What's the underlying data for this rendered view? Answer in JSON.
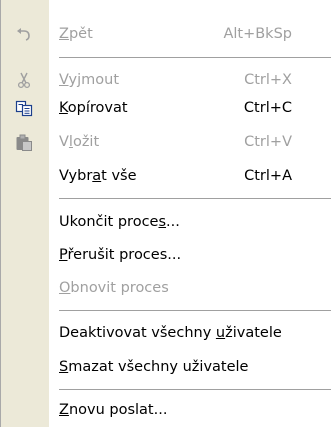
{
  "menu": {
    "items": [
      {
        "name": "undo",
        "pre": "",
        "key": "Z",
        "post": "pět",
        "shortcut": "Alt+BkSp",
        "icon": "undo-icon",
        "disabled": true
      },
      {
        "name": "cut",
        "pre": "",
        "key": "V",
        "post": "yjmout",
        "shortcut": "Ctrl+X",
        "icon": "scissors-icon",
        "disabled": true
      },
      {
        "name": "copy",
        "pre": "",
        "key": "K",
        "post": "opírovat",
        "shortcut": "Ctrl+C",
        "icon": "copy-icon",
        "disabled": false
      },
      {
        "name": "paste",
        "pre": "V",
        "key": "l",
        "post": "ožit",
        "shortcut": "Ctrl+V",
        "icon": "paste-icon",
        "disabled": true
      },
      {
        "name": "select-all",
        "pre": "Vybr",
        "key": "a",
        "post": "t vše",
        "shortcut": "Ctrl+A",
        "icon": "",
        "disabled": false
      },
      {
        "name": "end-process",
        "pre": "Ukončit proce",
        "key": "s",
        "post": "...",
        "shortcut": "",
        "icon": "",
        "disabled": false
      },
      {
        "name": "interrupt-process",
        "pre": "",
        "key": "P",
        "post": "řerušit proces...",
        "shortcut": "",
        "icon": "",
        "disabled": false
      },
      {
        "name": "resume-process",
        "pre": "",
        "key": "O",
        "post": "bnovit proces",
        "shortcut": "",
        "icon": "",
        "disabled": true
      },
      {
        "name": "deactivate-all-users",
        "pre": "Deaktivovat všechny ",
        "key": "u",
        "post": "živatele",
        "shortcut": "",
        "icon": "",
        "disabled": false
      },
      {
        "name": "delete-all-users",
        "pre": "",
        "key": "S",
        "post": "mazat všechny uživatele",
        "shortcut": "",
        "icon": "",
        "disabled": false
      },
      {
        "name": "resend",
        "pre": "",
        "key": "Z",
        "post": "novu poslat...",
        "shortcut": "",
        "icon": "",
        "disabled": false
      }
    ],
    "colors": {
      "icon_strip": "#ece9d8",
      "disabled_text": "#a0a0a0",
      "separator": "#a0a0a0"
    }
  }
}
